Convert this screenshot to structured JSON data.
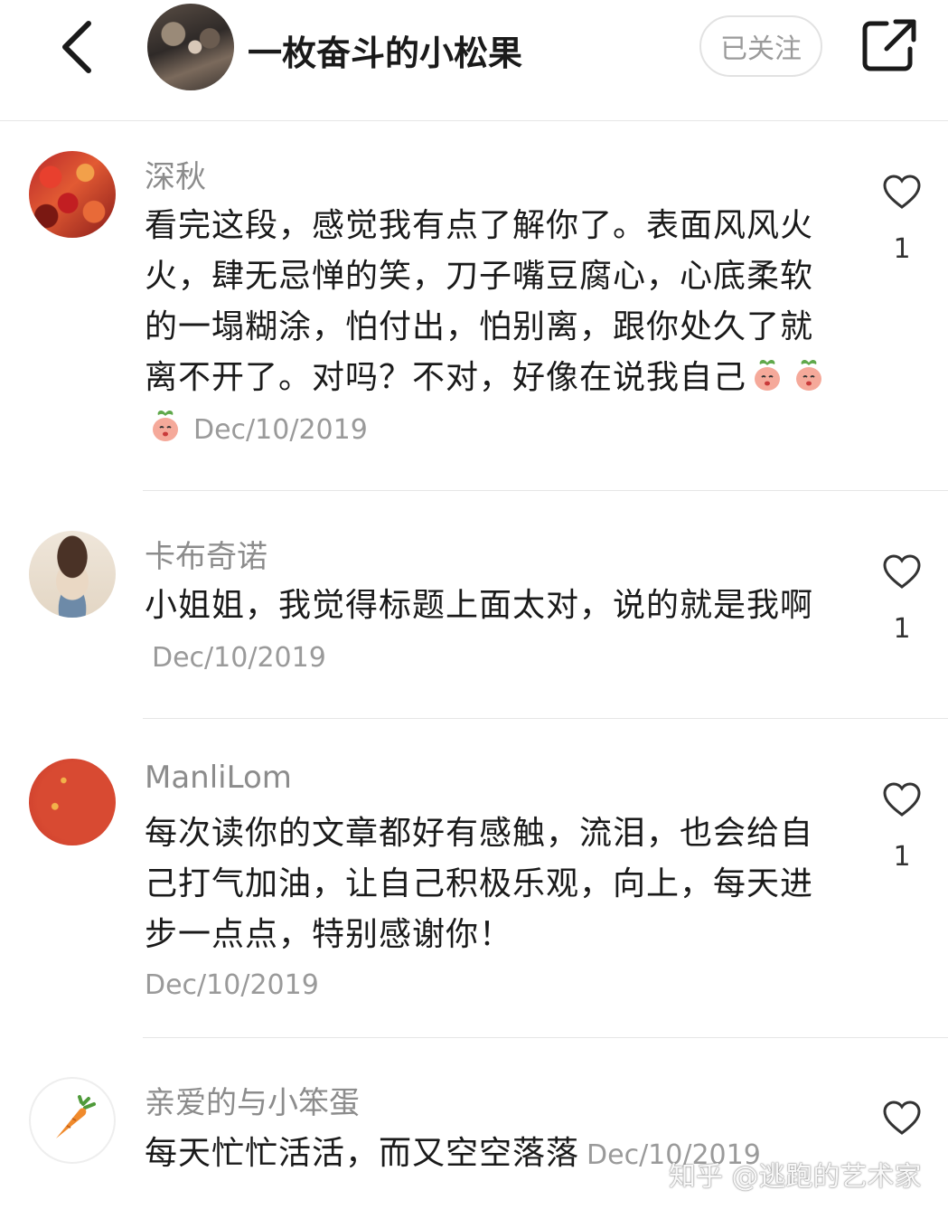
{
  "header": {
    "author_name": "一枚奋斗的小松果",
    "follow_label": "已关注"
  },
  "comments": [
    {
      "username": "深秋",
      "text": "看完这段，感觉我有点了解你了。表面风风火火，肆无忌惮的笑，刀子嘴豆腐心，心底柔软的一塌糊涂，怕付出，怕别离，跟你处久了就离不开了。对吗？不对，好像在说我自己",
      "date": "Dec/10/2019",
      "likes": "1",
      "emojis": [
        "peach-emoji",
        "peach-emoji",
        "peach-emoji"
      ]
    },
    {
      "username": "卡布奇诺",
      "text": "小姐姐，我觉得标题上面太对，说的就是我啊",
      "date": "Dec/10/2019",
      "likes": "1"
    },
    {
      "username": "ManliLom",
      "text": "每次读你的文章都好有感触，流泪，也会给自己打气加油，让自己积极乐观，向上，每天进步一点点，特别感谢你！",
      "date": "Dec/10/2019",
      "likes": "1"
    },
    {
      "username": "亲爱的与小笨蛋",
      "text": "每天忙忙活活，而又空空落落",
      "date": "Dec/10/2019"
    }
  ],
  "watermark": "知乎 @逃跑的艺术家",
  "colors": {
    "text": "#1a1a1a",
    "muted": "#9a9a9a",
    "divider": "#e6e6e6",
    "accent": "#d84a32"
  }
}
